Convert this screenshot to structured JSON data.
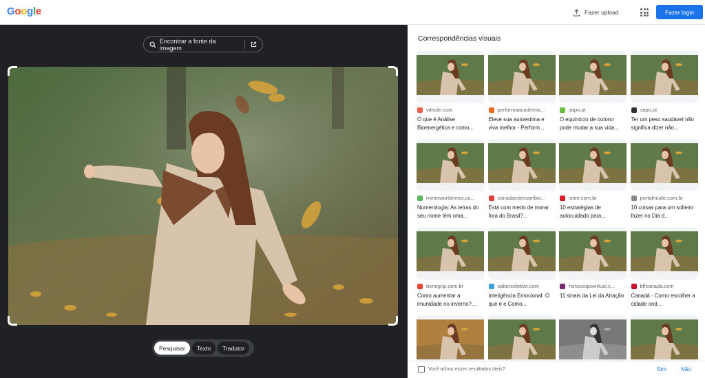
{
  "header": {
    "logo_letters": [
      {
        "ch": "G",
        "color": "#4285f4"
      },
      {
        "ch": "o",
        "color": "#ea4335"
      },
      {
        "ch": "o",
        "color": "#fbbc05"
      },
      {
        "ch": "g",
        "color": "#4285f4"
      },
      {
        "ch": "l",
        "color": "#34a853"
      },
      {
        "ch": "e",
        "color": "#ea4335"
      }
    ],
    "upload_label": "Fazer upload",
    "upload_icon": "upload-icon",
    "apps_icon": "apps-grid-icon",
    "login_label": "Fazer login"
  },
  "viewer": {
    "find_source_label": "Encontrar a fonte da imagem",
    "find_source_icon": "lens-icon",
    "open_icon": "open-in-new-icon",
    "modes": [
      {
        "label": "Pesquisar",
        "active": true
      },
      {
        "label": "Texto",
        "active": false
      },
      {
        "label": "Tradutor",
        "active": false
      }
    ]
  },
  "results": {
    "heading": "Correspondências visuais",
    "cards": [
      {
        "source": "vittude.com",
        "favicon_color": "#e8604c",
        "title": "O que é Análise Bioenergética e como..."
      },
      {
        "source": "performaacademia...",
        "favicon_color": "#f26b1d",
        "title": "Eleve sua autoestima e viva melhor - Perform..."
      },
      {
        "source": "sapo.pt",
        "favicon_color": "#6abf3d",
        "title": "O equinócio de outono pode mudar a sua vida..."
      },
      {
        "source": "sapo.pt",
        "favicon_color": "#333333",
        "title": "Ter um peso saudável não significa dizer não..."
      },
      {
        "source": "metroworldnews.co...",
        "favicon_color": "#5cb85c",
        "title": "Numerologia: As letras do seu nome têm uma..."
      },
      {
        "source": "canadaintercambio...",
        "favicon_color": "#e0403a",
        "title": "Está com medo de morar fora do Brasil?..."
      },
      {
        "source": "istoe.com.br",
        "favicon_color": "#d81e2a",
        "title": "10 estratégias de autocuidado para..."
      },
      {
        "source": "portalmude.com.br",
        "favicon_color": "#888888",
        "title": "10 coisas para um solteiro fazer no Dia d..."
      },
      {
        "source": "benegrip.com.br",
        "favicon_color": "#e24a2e",
        "title": "Como aumentar a imunidade no inverno?..."
      },
      {
        "source": "sabercoletivo.com",
        "favicon_color": "#3aa0d8",
        "title": "Inteligência Emocional: O que é e Como..."
      },
      {
        "source": "horoscopovirtual.c...",
        "favicon_color": "#7a2a6e",
        "title": "11 sinais da Lei da Atração"
      },
      {
        "source": "bffcanada.com",
        "favicon_color": "#c8102e",
        "title": "Canadá - Como escolher a cidade ond..."
      },
      {
        "source": "",
        "favicon_color": "",
        "title": ""
      },
      {
        "source": "",
        "favicon_color": "",
        "title": ""
      },
      {
        "source": "",
        "favicon_color": "",
        "title": ""
      },
      {
        "source": "",
        "favicon_color": "",
        "title": ""
      }
    ]
  },
  "feedback": {
    "question": "Você achou esses resultados úteis?",
    "yes": "Sim",
    "no": "Não",
    "icon": "feedback-icon"
  }
}
